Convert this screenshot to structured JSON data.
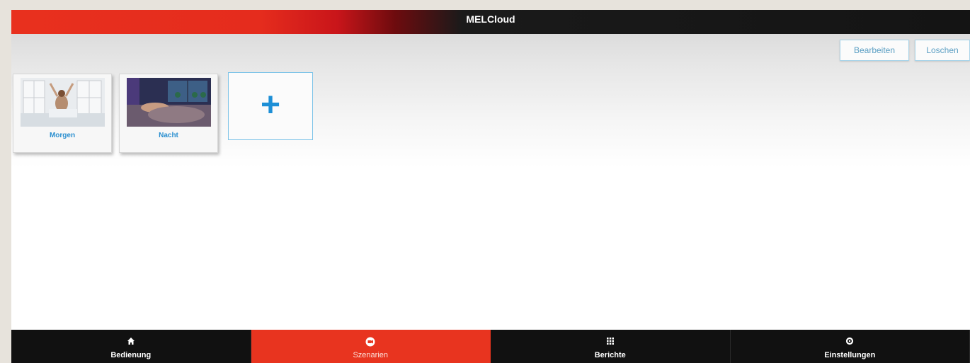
{
  "app": {
    "title": "MELCloud"
  },
  "toolbar": {
    "edit_label": "Bearbeiten",
    "delete_label": "Loschen"
  },
  "scenarios": [
    {
      "label": "Morgen",
      "image": "morning-scene"
    },
    {
      "label": "Nacht",
      "image": "night-scene"
    }
  ],
  "add_scenario": {
    "icon": "plus-icon",
    "symbol": "+"
  },
  "bottom_nav": {
    "items": [
      {
        "label": "Bedienung",
        "icon": "home-icon",
        "active": false
      },
      {
        "label": "Szenarien",
        "icon": "camera-icon",
        "active": true
      },
      {
        "label": "Berichte",
        "icon": "grid-icon",
        "active": false
      },
      {
        "label": "Einstellungen",
        "icon": "gear-icon",
        "active": false
      }
    ]
  },
  "colors": {
    "accent_red": "#e8341f",
    "link_blue": "#2a8fd0",
    "bar_dark": "#111111"
  }
}
